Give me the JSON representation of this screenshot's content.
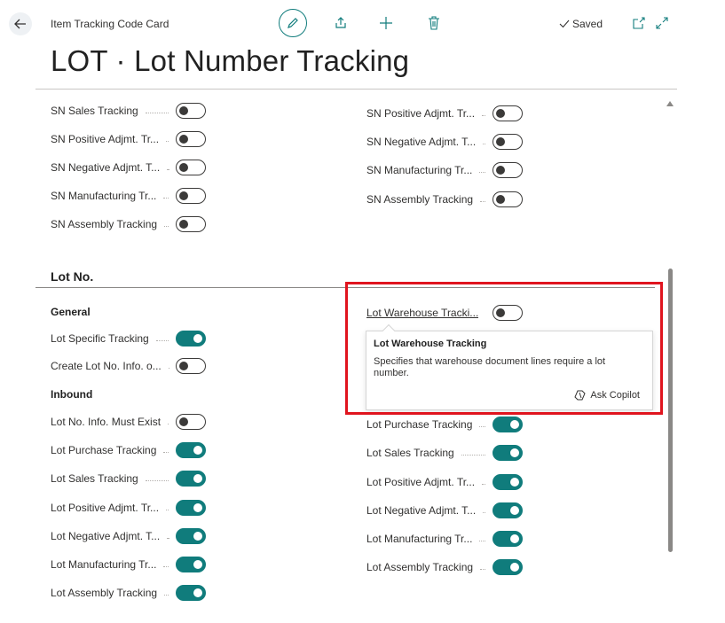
{
  "header": {
    "breadcrumb": "Item Tracking Code Card",
    "saved_label": "Saved",
    "title": "LOT · Lot Number Tracking"
  },
  "sn_section": {
    "left": [
      {
        "label": "SN Sales Tracking",
        "on": false
      },
      {
        "label": "SN Positive Adjmt. Tr...",
        "on": false
      },
      {
        "label": "SN Negative Adjmt. T...",
        "on": false
      },
      {
        "label": "SN Manufacturing Tr...",
        "on": false
      },
      {
        "label": "SN Assembly Tracking",
        "on": false
      }
    ],
    "right": [
      {
        "label": "SN Positive Adjmt. Tr...",
        "on": false
      },
      {
        "label": "SN Negative Adjmt. T...",
        "on": false
      },
      {
        "label": "SN Manufacturing Tr...",
        "on": false
      },
      {
        "label": "SN Assembly Tracking",
        "on": false
      }
    ]
  },
  "lot_section": {
    "title": "Lot No.",
    "general_title": "General",
    "inbound_title": "Inbound",
    "general": [
      {
        "label": "Lot Specific Tracking",
        "on": true
      },
      {
        "label": "Create Lot No. Info. o...",
        "on": false
      }
    ],
    "inbound": [
      {
        "label": "Lot No. Info. Must Exist",
        "on": false
      },
      {
        "label": "Lot Purchase Tracking",
        "on": true
      },
      {
        "label": "Lot Sales Tracking",
        "on": true
      },
      {
        "label": "Lot Positive Adjmt. Tr...",
        "on": true
      },
      {
        "label": "Lot Negative Adjmt. T...",
        "on": true
      },
      {
        "label": "Lot Manufacturing Tr...",
        "on": true
      },
      {
        "label": "Lot Assembly Tracking",
        "on": true
      }
    ],
    "right_top": {
      "label": "Lot Warehouse Tracki...",
      "on": false
    },
    "right": [
      {
        "label": "Lot Purchase Tracking",
        "on": true
      },
      {
        "label": "Lot Sales Tracking",
        "on": true
      },
      {
        "label": "Lot Positive Adjmt. Tr...",
        "on": true
      },
      {
        "label": "Lot Negative Adjmt. T...",
        "on": true
      },
      {
        "label": "Lot Manufacturing Tr...",
        "on": true
      },
      {
        "label": "Lot Assembly Tracking",
        "on": true
      }
    ]
  },
  "tooltip": {
    "title": "Lot Warehouse Tracking",
    "body": "Specifies that warehouse document lines require a lot number.",
    "copilot_label": "Ask Copilot"
  },
  "colors": {
    "accent": "#107c7c",
    "highlight": "#e0141e"
  }
}
